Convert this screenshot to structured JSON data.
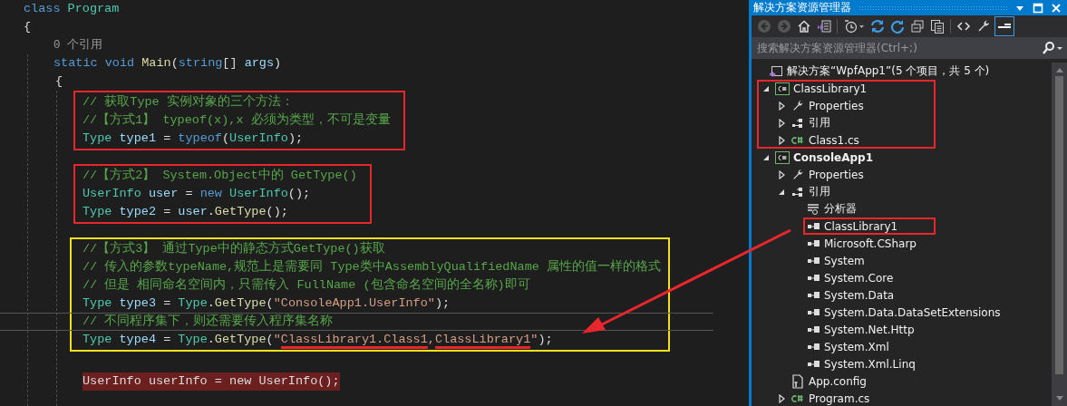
{
  "editor": {
    "class_line": [
      {
        "t": "class ",
        "kind": "keyword"
      },
      {
        "t": "Program",
        "kind": "type"
      }
    ],
    "open_brace": "{",
    "method": {
      "codelens": "0 个引用",
      "signature": [
        {
          "t": "static ",
          "kind": "keyword"
        },
        {
          "t": "void ",
          "kind": "keyword"
        },
        {
          "t": "Main",
          "kind": "method"
        },
        {
          "t": "(",
          "kind": "plain"
        },
        {
          "t": "string",
          "kind": "keyword"
        },
        {
          "t": "[] ",
          "kind": "plain"
        },
        {
          "t": "args",
          "kind": "var"
        },
        {
          "t": ")",
          "kind": "plain"
        }
      ],
      "open_brace": "{",
      "groups": [
        {
          "color": "#e8262c",
          "lines": [
            {
              "tokens": [
                {
                  "t": "// 获取Type 实例对象的三个方法：",
                  "kind": "comment"
                }
              ]
            },
            {
              "tokens": [
                {
                  "t": "//【方式1】 typeof(x),x 必须为类型，不可是变量",
                  "kind": "comment"
                }
              ]
            },
            {
              "tokens": [
                {
                  "t": "Type ",
                  "kind": "type"
                },
                {
                  "t": "type1",
                  "kind": "var"
                },
                {
                  "t": " = ",
                  "kind": "plain"
                },
                {
                  "t": "typeof",
                  "kind": "keyword"
                },
                {
                  "t": "(",
                  "kind": "plain"
                },
                {
                  "t": "UserInfo",
                  "kind": "type"
                },
                {
                  "t": ");",
                  "kind": "plain"
                }
              ]
            }
          ]
        },
        {
          "color": "#e8262c",
          "lines": [
            {
              "tokens": [
                {
                  "t": "//【方式2】 System.Object中的 GetType()",
                  "kind": "comment"
                }
              ]
            },
            {
              "tokens": [
                {
                  "t": "UserInfo ",
                  "kind": "type"
                },
                {
                  "t": "user",
                  "kind": "var"
                },
                {
                  "t": " = ",
                  "kind": "plain"
                },
                {
                  "t": "new ",
                  "kind": "keyword"
                },
                {
                  "t": "UserInfo",
                  "kind": "type"
                },
                {
                  "t": "();",
                  "kind": "plain"
                }
              ]
            },
            {
              "tokens": [
                {
                  "t": "Type ",
                  "kind": "type"
                },
                {
                  "t": "type2",
                  "kind": "var"
                },
                {
                  "t": " = ",
                  "kind": "plain"
                },
                {
                  "t": "user",
                  "kind": "var"
                },
                {
                  "t": ".",
                  "kind": "plain"
                },
                {
                  "t": "GetType",
                  "kind": "method"
                },
                {
                  "t": "();",
                  "kind": "plain"
                }
              ]
            }
          ]
        },
        {
          "color": "#f2e21a",
          "lines": [
            {
              "tokens": [
                {
                  "t": "//【方式3】 通过Type中的静态方式GetType()获取",
                  "kind": "comment"
                }
              ]
            },
            {
              "tokens": [
                {
                  "t": "// 传入的参数typeName,规范上是需要同 Type类中AssemblyQualifiedName 属性的值一样的格式",
                  "kind": "comment"
                }
              ]
            },
            {
              "tokens": [
                {
                  "t": "// 但是 相同命名空间内，只需传入 FullName (包含命名空间的全名称)即可",
                  "kind": "comment"
                }
              ]
            },
            {
              "tokens": [
                {
                  "t": "Type ",
                  "kind": "type"
                },
                {
                  "t": "type3",
                  "kind": "var"
                },
                {
                  "t": " = ",
                  "kind": "plain"
                },
                {
                  "t": "Type",
                  "kind": "type"
                },
                {
                  "t": ".",
                  "kind": "plain"
                },
                {
                  "t": "GetType",
                  "kind": "method"
                },
                {
                  "t": "(",
                  "kind": "plain"
                },
                {
                  "t": "\"ConsoleApp1.UserInfo\"",
                  "kind": "string"
                },
                {
                  "t": ");",
                  "kind": "plain"
                }
              ]
            },
            {
              "current": true,
              "tokens": [
                {
                  "t": "// 不同程序集下，则还需要传入程序集名称",
                  "kind": "comment"
                }
              ]
            },
            {
              "tokens": [
                {
                  "t": "Type ",
                  "kind": "type"
                },
                {
                  "t": "type4",
                  "kind": "var"
                },
                {
                  "t": " = ",
                  "kind": "plain"
                },
                {
                  "t": "Type",
                  "kind": "type"
                },
                {
                  "t": ".",
                  "kind": "plain"
                },
                {
                  "t": "GetType",
                  "kind": "method"
                },
                {
                  "t": "(",
                  "kind": "plain"
                },
                {
                  "t": "\"",
                  "kind": "string"
                },
                {
                  "t": "ClassLibrary1.Class1",
                  "kind": "string",
                  "underlined": true
                },
                {
                  "t": ",",
                  "kind": "string"
                },
                {
                  "t": "ClassLibrary1",
                  "kind": "string",
                  "underlined": true
                },
                {
                  "t": "\"",
                  "kind": "string"
                },
                {
                  "t": ");",
                  "kind": "plain"
                }
              ]
            }
          ]
        }
      ],
      "error_line": {
        "highlighted": true,
        "tokens": [
          {
            "t": "UserInfo userInfo = new UserInfo();",
            "kind": "plain"
          }
        ]
      }
    }
  },
  "explorer": {
    "title": "解决方案资源管理器",
    "search": {
      "placeholder": "搜索解决方案资源管理器(Ctrl+;)"
    },
    "tree": [
      {
        "label": "解决方案“WpfApp1”(5 个项目，共 5 个)",
        "kind": "solution",
        "children": [
          {
            "label": "ClassLibrary1",
            "kind": "project",
            "expanded": true,
            "boxed": true,
            "children": [
              {
                "label": "Properties",
                "kind": "properties",
                "expanded": false
              },
              {
                "label": "引用",
                "kind": "references",
                "expanded": false
              },
              {
                "label": "Class1.cs",
                "kind": "csfile",
                "expanded": false
              }
            ]
          },
          {
            "label": "ConsoleApp1",
            "kind": "project",
            "expanded": true,
            "startup": true,
            "children": [
              {
                "label": "Properties",
                "kind": "properties",
                "expanded": false
              },
              {
                "label": "引用",
                "kind": "references",
                "expanded": true,
                "children": [
                  {
                    "label": "分析器",
                    "kind": "analyzer"
                  },
                  {
                    "label": "ClassLibrary1",
                    "kind": "assembly",
                    "boxed": true
                  },
                  {
                    "label": "Microsoft.CSharp",
                    "kind": "assembly"
                  },
                  {
                    "label": "System",
                    "kind": "assembly"
                  },
                  {
                    "label": "System.Core",
                    "kind": "assembly"
                  },
                  {
                    "label": "System.Data",
                    "kind": "assembly"
                  },
                  {
                    "label": "System.Data.DataSetExtensions",
                    "kind": "assembly"
                  },
                  {
                    "label": "System.Net.Http",
                    "kind": "assembly"
                  },
                  {
                    "label": "System.Xml",
                    "kind": "assembly"
                  },
                  {
                    "label": "System.Xml.Linq",
                    "kind": "assembly"
                  }
                ]
              },
              {
                "label": "App.config",
                "kind": "config"
              },
              {
                "label": "Program.cs",
                "kind": "csfile",
                "expanded": false
              }
            ]
          }
        ]
      }
    ]
  }
}
